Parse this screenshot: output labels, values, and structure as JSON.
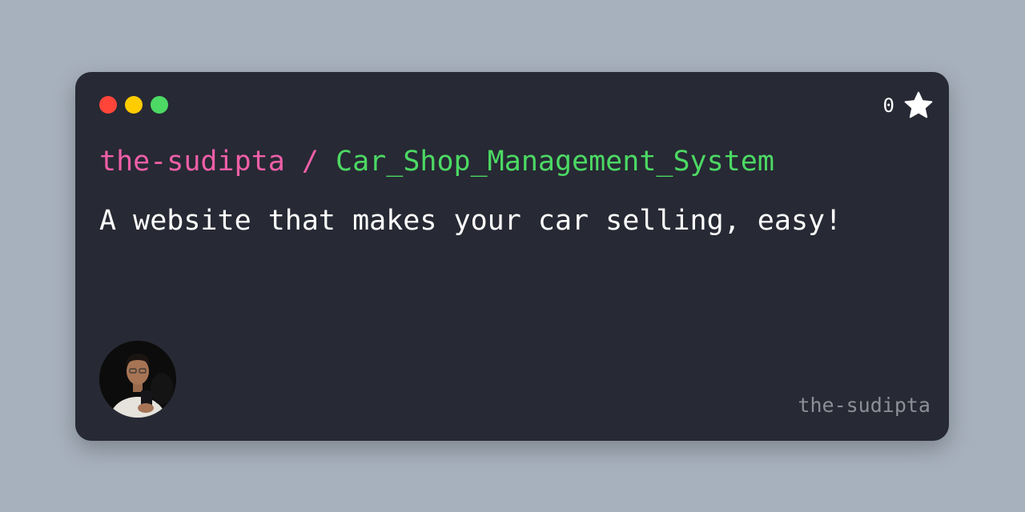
{
  "window": {
    "dots": [
      {
        "name": "close",
        "color": "#ff453a"
      },
      {
        "name": "minimize",
        "color": "#ffcc00"
      },
      {
        "name": "maximize",
        "color": "#4cd964"
      }
    ]
  },
  "stars": {
    "count": "0",
    "icon": "star-icon"
  },
  "repo": {
    "owner": "the-sudipta",
    "separator": "/",
    "name": "Car_Shop_Management_System"
  },
  "description": "A website that makes your car selling, easy!",
  "footer": {
    "avatar_icon": "avatar",
    "username": "the-sudipta"
  },
  "colors": {
    "background": "#a7b1bd",
    "card": "#272934",
    "owner": "#ef5fa7",
    "repo": "#4cd964",
    "text": "#ffffff",
    "muted": "#8d8f97"
  }
}
